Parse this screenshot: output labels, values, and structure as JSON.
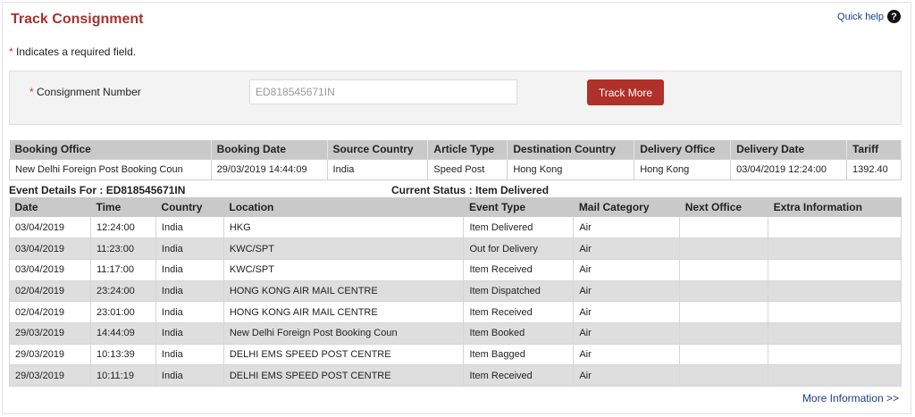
{
  "page": {
    "title": "Track Consignment",
    "quick_help": "Quick help",
    "required_note": "Indicates a required field.",
    "required_star": "*"
  },
  "form": {
    "label": "Consignment Number",
    "input_value": "ED818545671IN",
    "button_label": "Track More"
  },
  "booking": {
    "headers": [
      "Booking Office",
      "Booking Date",
      "Source Country",
      "Article Type",
      "Destination Country",
      "Delivery Office",
      "Delivery Date",
      "Tariff"
    ],
    "row": [
      "New Delhi Foreign Post Booking Coun",
      "29/03/2019 14:44:09",
      "India",
      "Speed Post",
      "Hong Kong",
      "Hong Kong",
      "03/04/2019 12:24:00",
      "1392.40"
    ]
  },
  "events": {
    "details_label": "Event Details For : ED818545671IN",
    "status_label": "Current Status : Item Delivered",
    "headers": [
      "Date",
      "Time",
      "Country",
      "Location",
      "Event Type",
      "Mail Category",
      "Next Office",
      "Extra Information"
    ],
    "rows": [
      [
        "03/04/2019",
        "12:24:00",
        "India",
        "HKG",
        "Item Delivered",
        "Air",
        "",
        ""
      ],
      [
        "03/04/2019",
        "11:23:00",
        "India",
        "KWC/SPT",
        "Out for Delivery",
        "Air",
        "",
        ""
      ],
      [
        "03/04/2019",
        "11:17:00",
        "India",
        "KWC/SPT",
        "Item Received",
        "Air",
        "",
        ""
      ],
      [
        "02/04/2019",
        "23:24:00",
        "India",
        "HONG KONG AIR MAIL CENTRE",
        "Item Dispatched",
        "Air",
        "",
        ""
      ],
      [
        "02/04/2019",
        "23:01:00",
        "India",
        "HONG KONG AIR MAIL CENTRE",
        "Item Received",
        "Air",
        "",
        ""
      ],
      [
        "29/03/2019",
        "14:44:09",
        "India",
        "New Delhi Foreign Post Booking Coun",
        "Item Booked",
        "Air",
        "",
        ""
      ],
      [
        "29/03/2019",
        "10:13:39",
        "India",
        "DELHI EMS SPEED POST CENTRE",
        "Item Bagged",
        "Air",
        "",
        ""
      ],
      [
        "29/03/2019",
        "10:11:19",
        "India",
        "DELHI EMS SPEED POST CENTRE",
        "Item Received",
        "Air",
        "",
        ""
      ]
    ]
  },
  "footer": {
    "more_info": "More Information >>"
  },
  "colors": {
    "brand_red": "#b0302a",
    "link_blue": "#1a3d8f"
  }
}
